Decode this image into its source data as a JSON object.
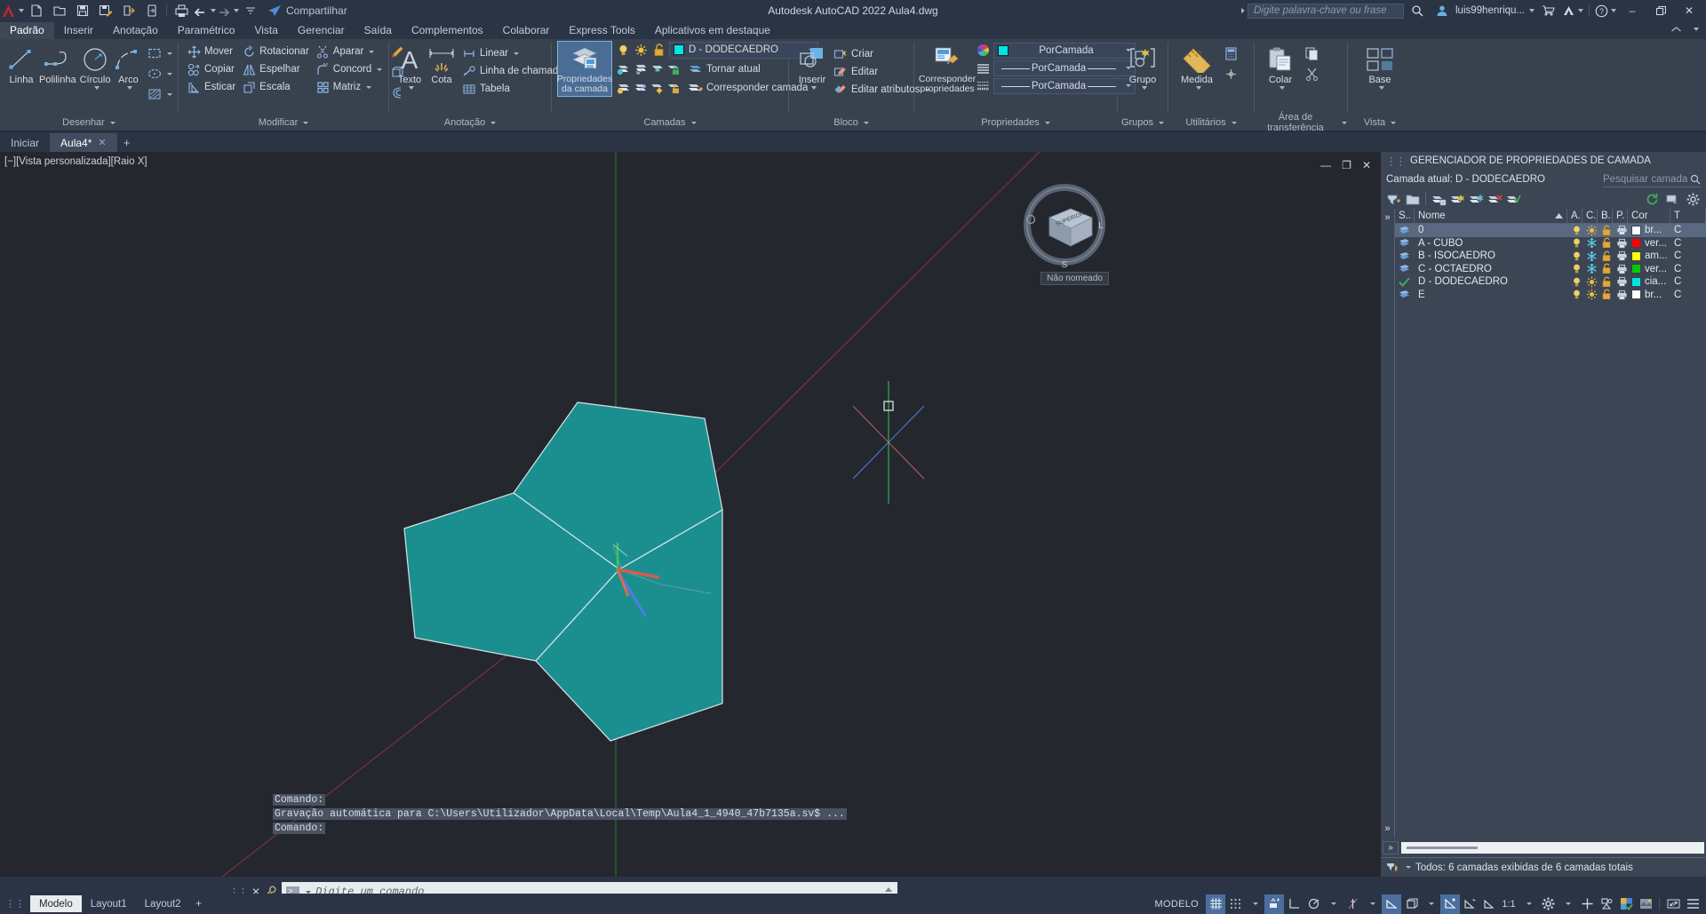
{
  "titlebar": {
    "app_title": "Autodesk AutoCAD 2022   Aula4.dwg",
    "share_label": "Compartilhar",
    "search_placeholder": "Digite palavra-chave ou frase",
    "user": "luis99henriqu...",
    "quick_access": [
      {
        "name": "app-menu",
        "label": "A"
      },
      {
        "name": "new-file",
        "label": ""
      },
      {
        "name": "open-file",
        "label": ""
      },
      {
        "name": "save",
        "label": ""
      },
      {
        "name": "save-as",
        "label": ""
      },
      {
        "name": "cloud-save",
        "label": ""
      },
      {
        "name": "export",
        "label": ""
      },
      {
        "name": "plot",
        "label": ""
      },
      {
        "name": "undo",
        "label": ""
      },
      {
        "name": "redo",
        "label": ""
      }
    ],
    "window_min": "–",
    "window_max": "❐",
    "window_close": "✕"
  },
  "menu_tabs": [
    {
      "label": "Padrão",
      "active": true
    },
    {
      "label": "Inserir",
      "active": false
    },
    {
      "label": "Anotação",
      "active": false
    },
    {
      "label": "Paramétrico",
      "active": false
    },
    {
      "label": "Vista",
      "active": false
    },
    {
      "label": "Gerenciar",
      "active": false
    },
    {
      "label": "Saída",
      "active": false
    },
    {
      "label": "Complementos",
      "active": false
    },
    {
      "label": "Colaborar",
      "active": false
    },
    {
      "label": "Express Tools",
      "active": false
    },
    {
      "label": "Aplicativos em destaque",
      "active": false
    }
  ],
  "ribbon": {
    "draw": {
      "title": "Desenhar",
      "line": "Linha",
      "polyline": "Polilinha",
      "circle": "Círculo",
      "arc": "Arco"
    },
    "modify": {
      "title": "Modificar",
      "move": "Mover",
      "rotate": "Rotacionar",
      "trim": "Aparar",
      "copy": "Copiar",
      "mirror": "Espelhar",
      "fillet": "Concord",
      "stretch": "Esticar",
      "scale": "Escala",
      "array": "Matriz"
    },
    "annotation": {
      "title": "Anotação",
      "text": "Texto",
      "dim": "Cota",
      "linear": "Linear",
      "leader": "Linha de chamada",
      "table": "Tabela"
    },
    "layers": {
      "title": "Camadas",
      "layer_properties": "Propriedades\nda camada",
      "layer_properties_l1": "Propriedades",
      "layer_properties_l2": "da camada",
      "current_layer": "D - DODECAEDRO",
      "current_layer_color": "#00e5e5",
      "make_current": "Tornar atual",
      "match_layer": "Corresponder camada"
    },
    "block": {
      "title": "Bloco",
      "insert": "Inserir",
      "create": "Criar",
      "edit": "Editar",
      "edit_attributes": "Editar atributos"
    },
    "properties": {
      "title": "Propriedades",
      "match_properties_l1": "Corresponder",
      "match_properties_l2": "propriedades",
      "color": "PorCamada",
      "color_swatch": "#00e5e5",
      "linetype": "PorCamada",
      "lineweight": "PorCamada"
    },
    "groups": {
      "title": "Grupos",
      "group": "Grupo"
    },
    "utilities": {
      "title": "Utilitários",
      "measure": "Medida"
    },
    "clipboard": {
      "title": "Área de transferência",
      "paste": "Colar"
    },
    "view": {
      "title": "Vista",
      "base": "Base"
    }
  },
  "file_tabs": [
    {
      "label": "Iniciar",
      "active": false,
      "closable": false
    },
    {
      "label": "Aula4*",
      "active": true,
      "closable": true
    }
  ],
  "file_tab_add": "+",
  "canvas": {
    "viewport_label": "[−][Vista personalizada][Raio X]",
    "navcube_label": "Não nomeado",
    "navcube_faces": [
      "SUPERIOR",
      "L",
      "S"
    ],
    "shape_fill": "#1b8f8f",
    "shape_stroke": "#d9e3ea",
    "background": "#24282e"
  },
  "command": {
    "history": [
      "Comando:",
      "Gravação automática para C:\\Users\\Utilizador\\AppData\\Local\\Temp\\Aula4_1_4940_47b7135a.sv$ ...",
      "Comando:"
    ],
    "placeholder": "Digite um comando",
    "close_icon": "✕",
    "wrench_icon": "⚒"
  },
  "palette": {
    "title": "GERENCIADOR DE PROPRIEDADES DE CAMADA",
    "current_layer_label": "Camada atual: D - DODECAEDRO",
    "search_placeholder": "Pesquisar camada",
    "toolbar_buttons": [
      "new-property-filter",
      "new-group-filter",
      "layer-states-manager",
      "new-layer",
      "new-layer-vp-frozen",
      "delete-layer",
      "set-current"
    ],
    "refresh_icon": "refresh-icon",
    "settings_icon": "gear-icon",
    "columns": [
      "S..",
      "Nome",
      "A.",
      "C.",
      "B.",
      "P.",
      "Cor",
      "T"
    ],
    "rows": [
      {
        "status": "layer",
        "name": "0",
        "on": true,
        "freeze": "sun",
        "lock": "unlocked",
        "plot": true,
        "color_name": "br...",
        "color": "#ffffff",
        "selected": true,
        "current": false
      },
      {
        "status": "layer",
        "name": "A - CUBO",
        "on": true,
        "freeze": "snow",
        "lock": "unlocked",
        "plot": true,
        "color_name": "ver...",
        "color": "#ff0000",
        "selected": false,
        "current": false
      },
      {
        "status": "layer",
        "name": "B - ISOCAEDRO",
        "on": true,
        "freeze": "snow",
        "lock": "unlocked",
        "plot": true,
        "color_name": "am...",
        "color": "#ffff00",
        "selected": false,
        "current": false
      },
      {
        "status": "layer",
        "name": "C - OCTAEDRO",
        "on": true,
        "freeze": "snow",
        "lock": "unlocked",
        "plot": true,
        "color_name": "ver...",
        "color": "#00cc00",
        "selected": false,
        "current": false
      },
      {
        "status": "current",
        "name": "D - DODECAEDRO",
        "on": true,
        "freeze": "sun",
        "lock": "unlocked",
        "plot": true,
        "color_name": "cia...",
        "color": "#00e5e5",
        "selected": false,
        "current": true
      },
      {
        "status": "layer",
        "name": "E",
        "on": true,
        "freeze": "sun",
        "lock": "unlocked",
        "plot": true,
        "color_name": "br...",
        "color": "#ffffff",
        "selected": false,
        "current": false
      }
    ],
    "footer": "Todos: 6 camadas exibidas de 6 camadas totais"
  },
  "layout_tabs": [
    {
      "label": "Modelo",
      "active": true
    },
    {
      "label": "Layout1",
      "active": false
    },
    {
      "label": "Layout2",
      "active": false
    }
  ],
  "layout_tab_add": "+",
  "statusbar": {
    "space": "MODELO",
    "scale": "1:1",
    "items": [
      {
        "name": "grid-display",
        "on": true
      },
      {
        "name": "snap-mode",
        "on": false
      },
      {
        "name": "infer-constraints",
        "on": true
      },
      {
        "name": "ortho-mode",
        "on": false
      },
      {
        "name": "polar-tracking",
        "on": false
      },
      {
        "name": "object-snap-tracking",
        "on": false
      },
      {
        "name": "object-snap",
        "on": true
      },
      {
        "name": "3d-object-snap",
        "on": false
      },
      {
        "name": "dynamic-ucs",
        "on": true
      },
      {
        "name": "dynamic-input",
        "on": false
      },
      {
        "name": "lineweight",
        "on": false
      },
      {
        "name": "transparency",
        "on": false
      },
      {
        "name": "annotation-scale",
        "on": false
      },
      {
        "name": "workspace-switching",
        "on": false
      },
      {
        "name": "hardware-acceleration",
        "on": false
      },
      {
        "name": "isolate-objects",
        "on": false
      },
      {
        "name": "clean-screen",
        "on": false
      },
      {
        "name": "customization",
        "on": false
      }
    ]
  }
}
